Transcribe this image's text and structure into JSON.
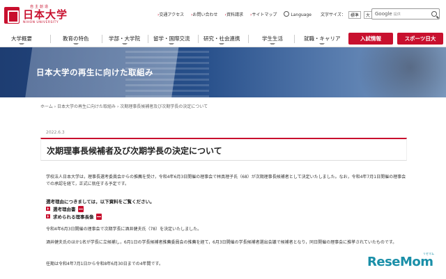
{
  "header": {
    "logo_small": "自主創造",
    "logo_main": "日本大学",
    "logo_en": "NIHON UNIVERSITY",
    "utility_links": [
      "交通アクセス",
      "お問い合わせ",
      "資料請求",
      "サイトマップ"
    ],
    "language_label": "Language",
    "font_size_label": "文字サイズ：",
    "font_size_options": [
      "標準",
      "大"
    ],
    "search_brand": "Google",
    "search_placeholder": "提供"
  },
  "nav": {
    "items": [
      "大学概要",
      "教育の特色",
      "学部・大学院",
      "留学・国際交流",
      "研究・社会連携",
      "学生生活",
      "就職・キャリア"
    ],
    "entrance_label": "入試情報",
    "sports_label": "スポーツ日大"
  },
  "hero": {
    "title": "日本大学の再生に向けた取組み"
  },
  "breadcrumb": {
    "text": "ホーム › 日本大学の再生に向けた取組み › 次期理事長候補者及び次期学長の決定について"
  },
  "article": {
    "date": "2022.6.3",
    "title": "次期理事長候補者及び次期学長の決定について",
    "para1": "学校法人日本大学は，理事長選考委員会からの推薦を受け，令和4年6月3日開催の理事会で林真理子氏（68）が次期理事長候補者として決定いたしました。なお，令和4年7月1日開催の理事会での承認を経て，正式に就任する予定です。",
    "notice": "選考理由につきましては，以下資料をご覧ください。",
    "doc1": "選考理由書",
    "doc2": "求められる理事長像",
    "para2": "令和4年6月3日開催の理事会で次期学長に酒井健夫氏（78）を決定いたしました。",
    "para3": "酒井健夫氏のほか1名が学長に立候補し，6月1日の学長候補者推薦委員会の推薦を経て，6月3日開催の学長候補者選出会議で候補者となり，同日開催の理事会に推挙されていたものです。",
    "para4": "任期は令和4年7月1日から令和8年6月30日までの4年間です。"
  },
  "watermark": {
    "brand": "ReseMom",
    "sub": "リセマム"
  },
  "colors": {
    "brand_red": "#c8102e",
    "hero_blue": "#274f8a",
    "watermark_teal": "#1a8fa8"
  }
}
